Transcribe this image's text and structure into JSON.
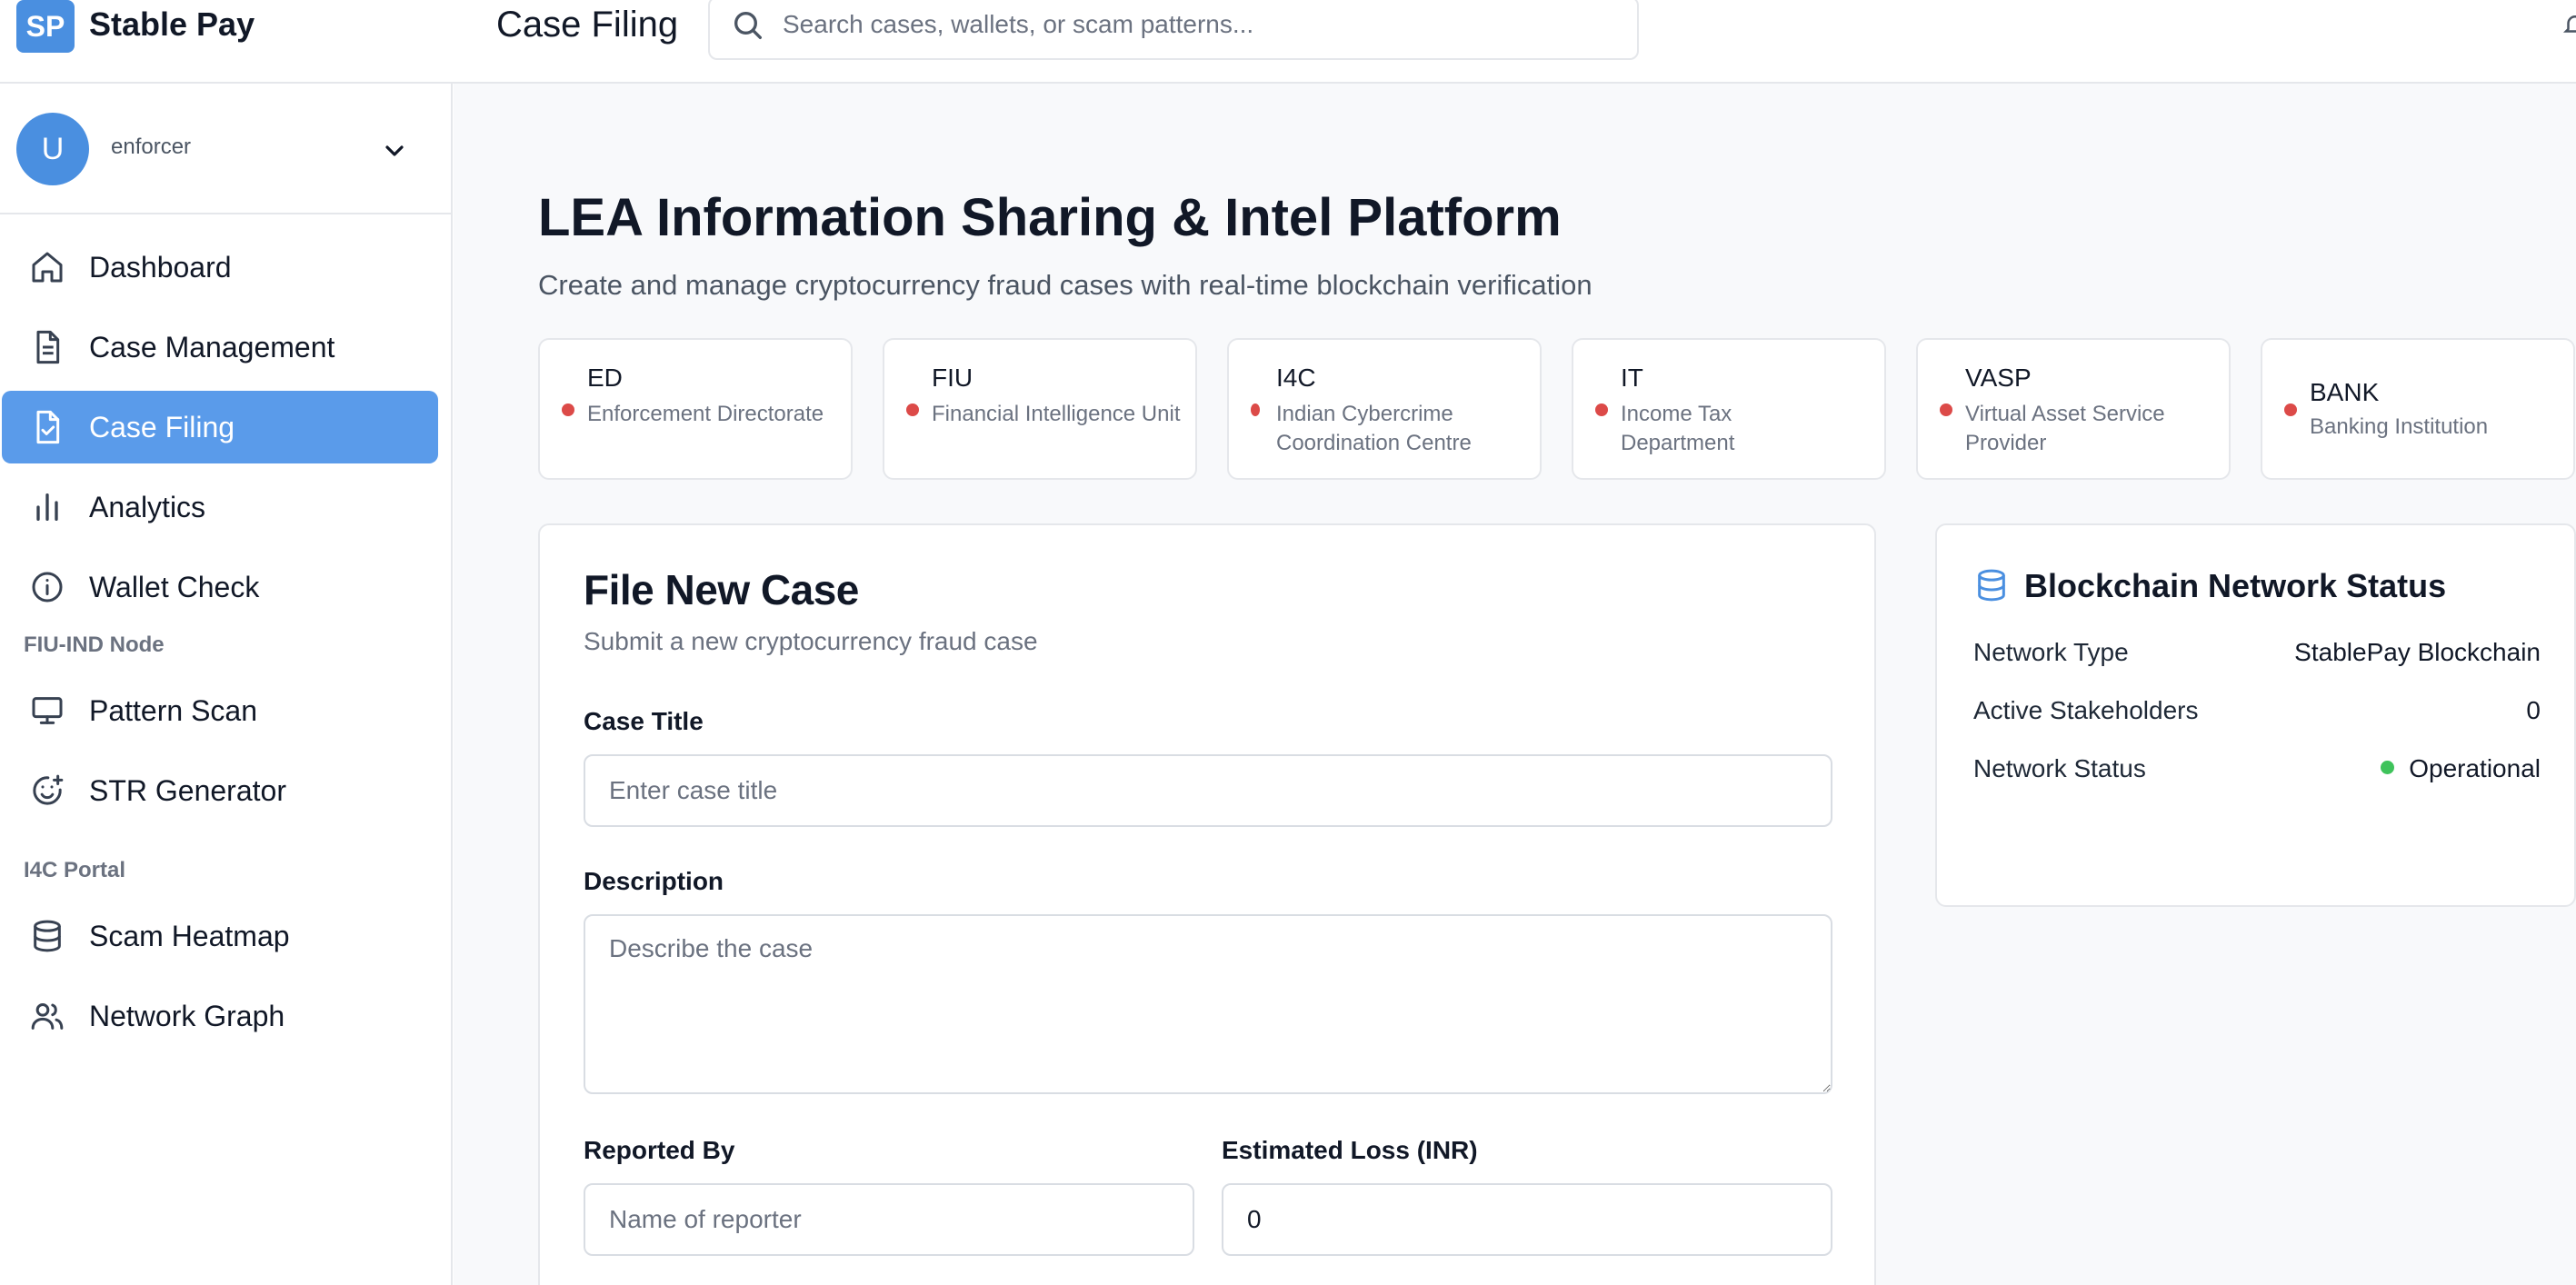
{
  "header": {
    "logo_text": "SP",
    "app_name": "Stable Pay",
    "page_title": "Case Filing",
    "search_placeholder": "Search cases, wallets, or scam patterns..."
  },
  "user": {
    "avatar_initial": "U",
    "name": "enforcer"
  },
  "sidebar": {
    "items": [
      {
        "label": "Dashboard",
        "icon": "home-icon"
      },
      {
        "label": "Case Management",
        "icon": "document-icon"
      },
      {
        "label": "Case Filing",
        "icon": "file-check-icon",
        "active": true
      },
      {
        "label": "Analytics",
        "icon": "bar-chart-icon"
      },
      {
        "label": "Wallet Check",
        "icon": "info-circle-icon"
      }
    ],
    "section_fiu": "FIU-IND Node",
    "fiu_items": [
      {
        "label": "Pattern Scan",
        "icon": "monitor-icon"
      },
      {
        "label": "STR Generator",
        "icon": "smile-plus-icon"
      }
    ],
    "section_i4c": "I4C Portal",
    "i4c_items": [
      {
        "label": "Scam Heatmap",
        "icon": "database-icon"
      },
      {
        "label": "Network Graph",
        "icon": "users-icon"
      }
    ]
  },
  "main": {
    "title": "LEA Information Sharing & Intel Platform",
    "subtitle": "Create and manage cryptocurrency fraud cases with real-time blockchain verification",
    "agencies": [
      {
        "code": "ED",
        "name": "Enforcement Directorate"
      },
      {
        "code": "FIU",
        "name": "Financial Intelligence Unit"
      },
      {
        "code": "I4C",
        "name": "Indian Cybercrime Coordination Centre"
      },
      {
        "code": "IT",
        "name": "Income Tax Department"
      },
      {
        "code": "VASP",
        "name": "Virtual Asset Service Provider"
      },
      {
        "code": "BANK",
        "name": "Banking Institution"
      }
    ],
    "agency_status_color": "#dc4a48"
  },
  "form": {
    "title": "File New Case",
    "subtitle": "Submit a new cryptocurrency fraud case",
    "case_title_label": "Case Title",
    "case_title_placeholder": "Enter case title",
    "description_label": "Description",
    "description_placeholder": "Describe the case",
    "reported_by_label": "Reported By",
    "reported_by_placeholder": "Name of reporter",
    "estimated_loss_label": "Estimated Loss (INR)",
    "estimated_loss_value": "0"
  },
  "network_status": {
    "title": "Blockchain Network Status",
    "rows": [
      {
        "key": "Network Type",
        "value": "StablePay Blockchain"
      },
      {
        "key": "Active Stakeholders",
        "value": "0"
      },
      {
        "key": "Network Status",
        "value": "Operational"
      }
    ],
    "operational_color": "#3fc35b"
  },
  "colors": {
    "accent": "#4a8fe0",
    "active_nav": "#5a9bea"
  }
}
